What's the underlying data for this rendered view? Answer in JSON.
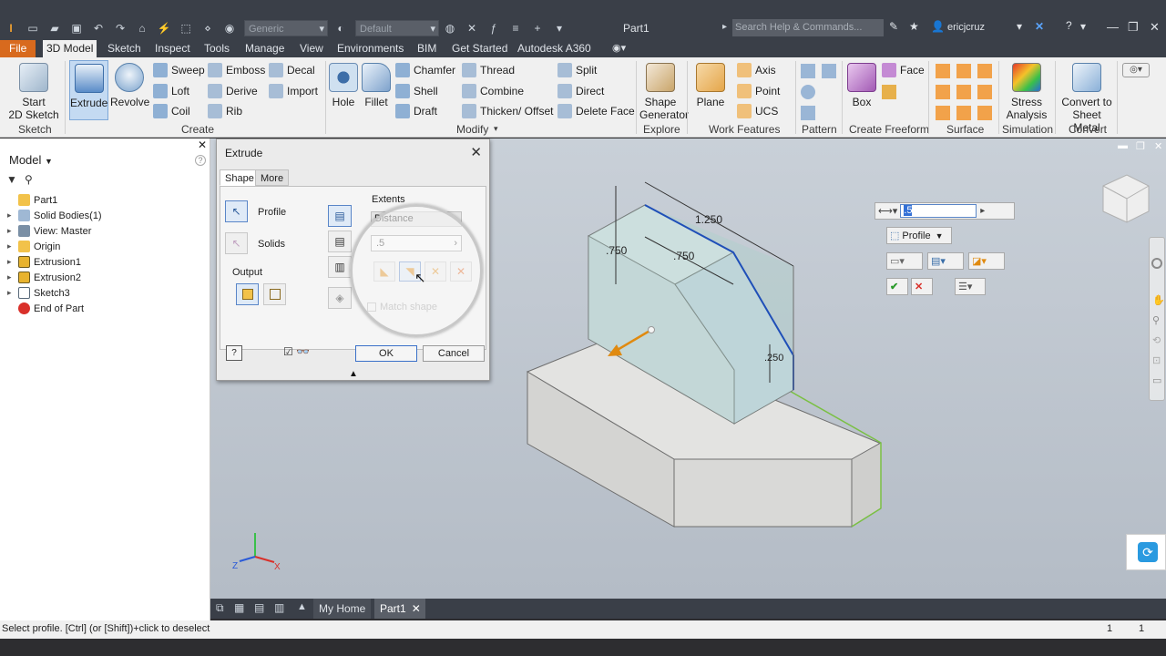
{
  "titlebar": {
    "material_combo": "Generic",
    "appearance_combo": "Default",
    "document_title": "Part1",
    "search_placeholder": "Search Help & Commands...",
    "user_name": "ericjcruz"
  },
  "menu": {
    "file": "File",
    "tabs": [
      "3D Model",
      "Sketch",
      "Inspect",
      "Tools",
      "Manage",
      "View",
      "Environments",
      "BIM",
      "Get Started",
      "Autodesk A360"
    ]
  },
  "ribbon": {
    "sketch": {
      "start": "Start",
      "start2": "2D Sketch",
      "panel": "Sketch"
    },
    "create": {
      "extrude": "Extrude",
      "revolve": "Revolve",
      "sweep": "Sweep",
      "loft": "Loft",
      "coil": "Coil",
      "emboss": "Emboss",
      "derive": "Derive",
      "rib": "Rib",
      "decal": "Decal",
      "import": "Import",
      "panel": "Create"
    },
    "modify": {
      "hole": "Hole",
      "fillet": "Fillet",
      "chamfer": "Chamfer",
      "shell": "Shell",
      "draft": "Draft",
      "thread": "Thread",
      "combine": "Combine",
      "thicken": "Thicken/ Offset",
      "split": "Split",
      "direct": "Direct",
      "delete_face": "Delete Face",
      "panel": "Modify"
    },
    "explore": {
      "shape": "Shape",
      "generator": "Generator",
      "panel": "Explore"
    },
    "work": {
      "plane": "Plane",
      "axis": "Axis",
      "point": "Point",
      "ucs": "UCS",
      "panel": "Work Features"
    },
    "pattern": {
      "panel": "Pattern"
    },
    "freeform": {
      "box": "Box",
      "face": "Face",
      "panel": "Create Freeform"
    },
    "surface": {
      "panel": "Surface"
    },
    "simulation": {
      "stress": "Stress",
      "analysis": "Analysis",
      "panel": "Simulation"
    },
    "convert": {
      "convert_to": "Convert to",
      "sheet_metal": "Sheet Metal",
      "panel": "Convert"
    }
  },
  "browser": {
    "title": "Model",
    "items": [
      "Part1",
      "Solid Bodies(1)",
      "View: Master",
      "Origin",
      "Extrusion1",
      "Extrusion2",
      "Sketch3",
      "End of Part"
    ]
  },
  "dialog": {
    "title": "Extrude",
    "tab_shape": "Shape",
    "tab_more": "More",
    "profile": "Profile",
    "solids": "Solids",
    "output": "Output",
    "extents": "Extents",
    "extents_type": "Distance",
    "distance_value": ".5",
    "match_shape": "Match shape",
    "ok": "OK",
    "cancel": "Cancel"
  },
  "minitoolbar": {
    "distance_value": ".5",
    "profile": "Profile"
  },
  "dimensions": {
    "d1": "1.250",
    "d2": ".750",
    "d3": ".750",
    "d4": ".250"
  },
  "doc_tabs": {
    "home": "My Home",
    "part": "Part1"
  },
  "status": {
    "message": "Select profile. [Ctrl] (or [Shift])+click to deselect",
    "count1": "1",
    "count2": "1"
  },
  "colors": {
    "file_tab": "#d86a1e",
    "selection_blue": "#1f4fb8",
    "arrow_orange": "#e08a10",
    "edge_green": "#7ac043"
  }
}
